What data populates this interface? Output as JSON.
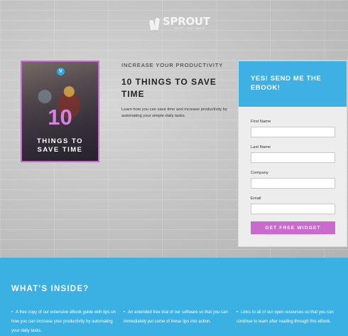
{
  "brand": {
    "name": "SPROUT",
    "tagline": "SMART SOFTWARE"
  },
  "book": {
    "badge": "V",
    "number": "10",
    "title_line1": "THINGS TO",
    "title_line2": "SAVE TIME"
  },
  "hero": {
    "kicker": "INCREASE YOUR PRODUCTIVITY",
    "headline": "10 THINGS TO SAVE TIME",
    "description": "Learn how you can save time and increase productivity by automating your simple daily tasks."
  },
  "form": {
    "title": "YES! SEND ME THE EBOOK!",
    "fields": [
      {
        "label": "First Name",
        "value": ""
      },
      {
        "label": "Last Name",
        "value": ""
      },
      {
        "label": "Company",
        "value": ""
      },
      {
        "label": "Email",
        "value": ""
      }
    ],
    "submit_label": "GET FREE WIDGET"
  },
  "inside": {
    "title": "WHAT'S INSIDE?",
    "bullet_glyph": "•",
    "items": [
      "A free copy of our extensive eBook guide with tips on how you can increase your productivity by automating your daily tasks.",
      "An extended free trial of our software so that you can immediately put some of these tips into action.",
      "Links to all of our open resources so that you can continue to learn after reading through this eBook."
    ]
  },
  "colors": {
    "accent_blue": "#3ab0e3",
    "accent_purple": "#c86bcd",
    "form_background": "#ededed"
  },
  "icons": [
    "sprout-logo-icon",
    "v-badge-icon"
  ]
}
